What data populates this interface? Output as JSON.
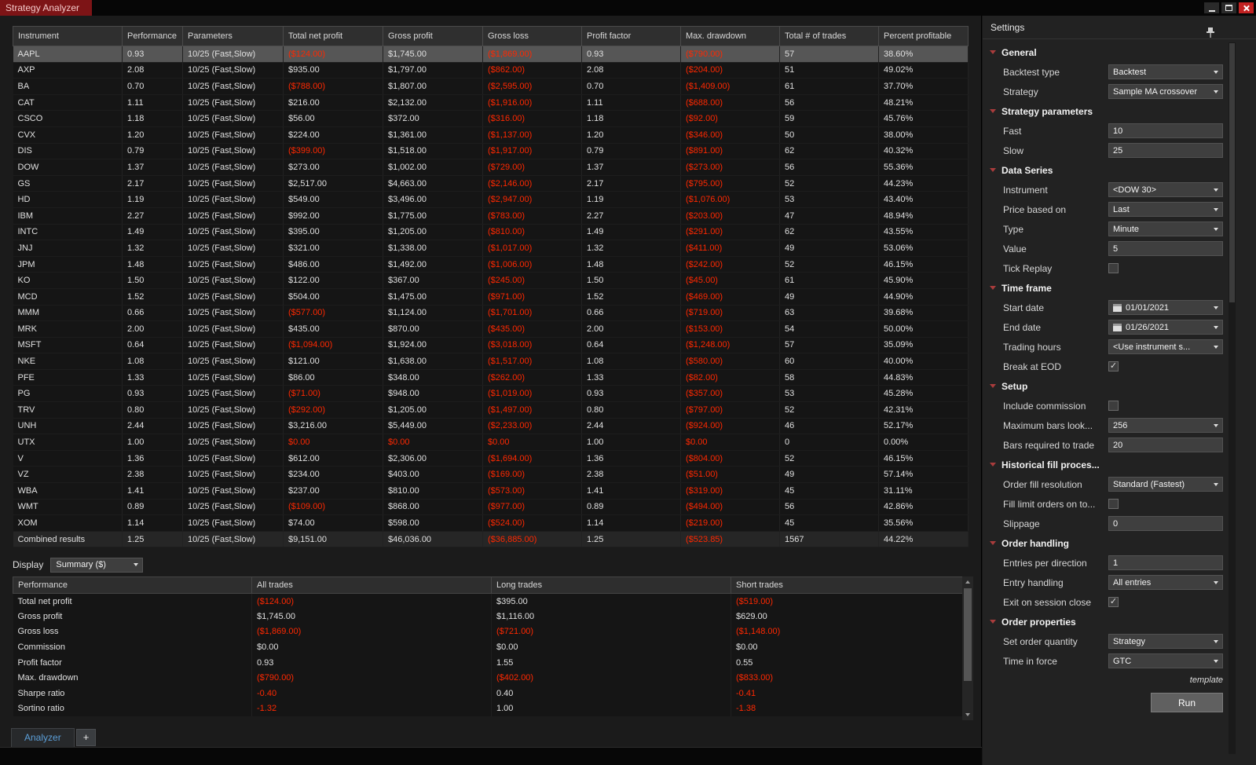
{
  "window": {
    "title": "Strategy Analyzer"
  },
  "colors": {
    "title_tab_red": "#7d1416",
    "negative_value_red": "#ff2800",
    "selected_row_gray": "#565656",
    "tab_text_blue": "#5c9fd8",
    "group_arrow_red": "#a93c3c"
  },
  "results": {
    "columns": [
      "Instrument",
      "Performance",
      "Parameters",
      "Total net profit",
      "Gross profit",
      "Gross loss",
      "Profit factor",
      "Max. drawdown",
      "Total # of trades",
      "Percent profitable"
    ],
    "currency_columns": [
      3,
      4,
      5,
      7
    ],
    "selected_row": 0,
    "rows": [
      [
        "AAPL",
        "0.93",
        "10/25 (Fast,Slow)",
        "($124.00)",
        "$1,745.00",
        "($1,869.00)",
        "0.93",
        "($790.00)",
        "57",
        "38.60%"
      ],
      [
        "AXP",
        "2.08",
        "10/25 (Fast,Slow)",
        "$935.00",
        "$1,797.00",
        "($862.00)",
        "2.08",
        "($204.00)",
        "51",
        "49.02%"
      ],
      [
        "BA",
        "0.70",
        "10/25 (Fast,Slow)",
        "($788.00)",
        "$1,807.00",
        "($2,595.00)",
        "0.70",
        "($1,409.00)",
        "61",
        "37.70%"
      ],
      [
        "CAT",
        "1.11",
        "10/25 (Fast,Slow)",
        "$216.00",
        "$2,132.00",
        "($1,916.00)",
        "1.11",
        "($688.00)",
        "56",
        "48.21%"
      ],
      [
        "CSCO",
        "1.18",
        "10/25 (Fast,Slow)",
        "$56.00",
        "$372.00",
        "($316.00)",
        "1.18",
        "($92.00)",
        "59",
        "45.76%"
      ],
      [
        "CVX",
        "1.20",
        "10/25 (Fast,Slow)",
        "$224.00",
        "$1,361.00",
        "($1,137.00)",
        "1.20",
        "($346.00)",
        "50",
        "38.00%"
      ],
      [
        "DIS",
        "0.79",
        "10/25 (Fast,Slow)",
        "($399.00)",
        "$1,518.00",
        "($1,917.00)",
        "0.79",
        "($891.00)",
        "62",
        "40.32%"
      ],
      [
        "DOW",
        "1.37",
        "10/25 (Fast,Slow)",
        "$273.00",
        "$1,002.00",
        "($729.00)",
        "1.37",
        "($273.00)",
        "56",
        "55.36%"
      ],
      [
        "GS",
        "2.17",
        "10/25 (Fast,Slow)",
        "$2,517.00",
        "$4,663.00",
        "($2,146.00)",
        "2.17",
        "($795.00)",
        "52",
        "44.23%"
      ],
      [
        "HD",
        "1.19",
        "10/25 (Fast,Slow)",
        "$549.00",
        "$3,496.00",
        "($2,947.00)",
        "1.19",
        "($1,076.00)",
        "53",
        "43.40%"
      ],
      [
        "IBM",
        "2.27",
        "10/25 (Fast,Slow)",
        "$992.00",
        "$1,775.00",
        "($783.00)",
        "2.27",
        "($203.00)",
        "47",
        "48.94%"
      ],
      [
        "INTC",
        "1.49",
        "10/25 (Fast,Slow)",
        "$395.00",
        "$1,205.00",
        "($810.00)",
        "1.49",
        "($291.00)",
        "62",
        "43.55%"
      ],
      [
        "JNJ",
        "1.32",
        "10/25 (Fast,Slow)",
        "$321.00",
        "$1,338.00",
        "($1,017.00)",
        "1.32",
        "($411.00)",
        "49",
        "53.06%"
      ],
      [
        "JPM",
        "1.48",
        "10/25 (Fast,Slow)",
        "$486.00",
        "$1,492.00",
        "($1,006.00)",
        "1.48",
        "($242.00)",
        "52",
        "46.15%"
      ],
      [
        "KO",
        "1.50",
        "10/25 (Fast,Slow)",
        "$122.00",
        "$367.00",
        "($245.00)",
        "1.50",
        "($45.00)",
        "61",
        "45.90%"
      ],
      [
        "MCD",
        "1.52",
        "10/25 (Fast,Slow)",
        "$504.00",
        "$1,475.00",
        "($971.00)",
        "1.52",
        "($469.00)",
        "49",
        "44.90%"
      ],
      [
        "MMM",
        "0.66",
        "10/25 (Fast,Slow)",
        "($577.00)",
        "$1,124.00",
        "($1,701.00)",
        "0.66",
        "($719.00)",
        "63",
        "39.68%"
      ],
      [
        "MRK",
        "2.00",
        "10/25 (Fast,Slow)",
        "$435.00",
        "$870.00",
        "($435.00)",
        "2.00",
        "($153.00)",
        "54",
        "50.00%"
      ],
      [
        "MSFT",
        "0.64",
        "10/25 (Fast,Slow)",
        "($1,094.00)",
        "$1,924.00",
        "($3,018.00)",
        "0.64",
        "($1,248.00)",
        "57",
        "35.09%"
      ],
      [
        "NKE",
        "1.08",
        "10/25 (Fast,Slow)",
        "$121.00",
        "$1,638.00",
        "($1,517.00)",
        "1.08",
        "($580.00)",
        "60",
        "40.00%"
      ],
      [
        "PFE",
        "1.33",
        "10/25 (Fast,Slow)",
        "$86.00",
        "$348.00",
        "($262.00)",
        "1.33",
        "($82.00)",
        "58",
        "44.83%"
      ],
      [
        "PG",
        "0.93",
        "10/25 (Fast,Slow)",
        "($71.00)",
        "$948.00",
        "($1,019.00)",
        "0.93",
        "($357.00)",
        "53",
        "45.28%"
      ],
      [
        "TRV",
        "0.80",
        "10/25 (Fast,Slow)",
        "($292.00)",
        "$1,205.00",
        "($1,497.00)",
        "0.80",
        "($797.00)",
        "52",
        "42.31%"
      ],
      [
        "UNH",
        "2.44",
        "10/25 (Fast,Slow)",
        "$3,216.00",
        "$5,449.00",
        "($2,233.00)",
        "2.44",
        "($924.00)",
        "46",
        "52.17%"
      ],
      [
        "UTX",
        "1.00",
        "10/25 (Fast,Slow)",
        "$0.00",
        "$0.00",
        "$0.00",
        "1.00",
        "$0.00",
        "0",
        "0.00%"
      ],
      [
        "V",
        "1.36",
        "10/25 (Fast,Slow)",
        "$612.00",
        "$2,306.00",
        "($1,694.00)",
        "1.36",
        "($804.00)",
        "52",
        "46.15%"
      ],
      [
        "VZ",
        "2.38",
        "10/25 (Fast,Slow)",
        "$234.00",
        "$403.00",
        "($169.00)",
        "2.38",
        "($51.00)",
        "49",
        "57.14%"
      ],
      [
        "WBA",
        "1.41",
        "10/25 (Fast,Slow)",
        "$237.00",
        "$810.00",
        "($573.00)",
        "1.41",
        "($319.00)",
        "45",
        "31.11%"
      ],
      [
        "WMT",
        "0.89",
        "10/25 (Fast,Slow)",
        "($109.00)",
        "$868.00",
        "($977.00)",
        "0.89",
        "($494.00)",
        "56",
        "42.86%"
      ],
      [
        "XOM",
        "1.14",
        "10/25 (Fast,Slow)",
        "$74.00",
        "$598.00",
        "($524.00)",
        "1.14",
        "($219.00)",
        "45",
        "35.56%"
      ],
      [
        "Combined results",
        "1.25",
        "10/25 (Fast,Slow)",
        "$9,151.00",
        "$46,036.00",
        "($36,885.00)",
        "1.25",
        "($523.85)",
        "1567",
        "44.22%"
      ]
    ]
  },
  "display": {
    "label": "Display",
    "value": "Summary ($)"
  },
  "summary": {
    "columns": [
      "Performance",
      "All trades",
      "Long trades",
      "Short trades"
    ],
    "rows": [
      [
        "Total net profit",
        "($124.00)",
        "$395.00",
        "($519.00)"
      ],
      [
        "Gross profit",
        "$1,745.00",
        "$1,116.00",
        "$629.00"
      ],
      [
        "Gross loss",
        "($1,869.00)",
        "($721.00)",
        "($1,148.00)"
      ],
      [
        "Commission",
        "$0.00",
        "$0.00",
        "$0.00"
      ],
      [
        "Profit factor",
        "0.93",
        "1.55",
        "0.55"
      ],
      [
        "Max. drawdown",
        "($790.00)",
        "($402.00)",
        "($833.00)"
      ],
      [
        "Sharpe ratio",
        "-0.40",
        "0.40",
        "-0.41"
      ],
      [
        "Sortino ratio",
        "-1.32",
        "1.00",
        "-1.38"
      ]
    ]
  },
  "tabs": {
    "active_label": "Analyzer",
    "add_label": "+"
  },
  "settings": {
    "title": "Settings",
    "template_label": "template",
    "run_label": "Run",
    "groups": [
      {
        "label": "General",
        "items": [
          {
            "label": "Backtest type",
            "type": "select",
            "value": "Backtest"
          },
          {
            "label": "Strategy",
            "type": "select",
            "value": "Sample MA crossover"
          }
        ]
      },
      {
        "label": "Strategy parameters",
        "items": [
          {
            "label": "Fast",
            "type": "input",
            "value": "10"
          },
          {
            "label": "Slow",
            "type": "input",
            "value": "25"
          }
        ]
      },
      {
        "label": "Data Series",
        "items": [
          {
            "label": "Instrument",
            "type": "select",
            "value": "<DOW 30>"
          },
          {
            "label": "Price based on",
            "type": "select",
            "value": "Last"
          },
          {
            "label": "Type",
            "type": "select",
            "value": "Minute"
          },
          {
            "label": "Value",
            "type": "input",
            "value": "5"
          },
          {
            "label": "Tick Replay",
            "type": "checkbox",
            "value": false
          }
        ]
      },
      {
        "label": "Time frame",
        "items": [
          {
            "label": "Start date",
            "type": "date",
            "value": "01/01/2021"
          },
          {
            "label": "End date",
            "type": "date",
            "value": "01/26/2021"
          },
          {
            "label": "Trading hours",
            "type": "select",
            "value": "<Use instrument s..."
          },
          {
            "label": "Break at EOD",
            "type": "checkbox",
            "value": true
          }
        ]
      },
      {
        "label": "Setup",
        "items": [
          {
            "label": "Include commission",
            "type": "checkbox",
            "value": false
          },
          {
            "label": "Maximum bars look...",
            "type": "select",
            "value": "256"
          },
          {
            "label": "Bars required to trade",
            "type": "input",
            "value": "20"
          }
        ]
      },
      {
        "label": "Historical fill proces...",
        "items": [
          {
            "label": "Order fill resolution",
            "type": "select",
            "value": "Standard (Fastest)"
          },
          {
            "label": "Fill limit orders on to...",
            "type": "checkbox",
            "value": false
          },
          {
            "label": "Slippage",
            "type": "input",
            "value": "0"
          }
        ]
      },
      {
        "label": "Order handling",
        "items": [
          {
            "label": "Entries per direction",
            "type": "input",
            "value": "1"
          },
          {
            "label": "Entry handling",
            "type": "select",
            "value": "All entries"
          },
          {
            "label": "Exit on session close",
            "type": "checkbox",
            "value": true
          }
        ]
      },
      {
        "label": "Order properties",
        "items": [
          {
            "label": "Set order quantity",
            "type": "select",
            "value": "Strategy"
          },
          {
            "label": "Time in force",
            "type": "select",
            "value": "GTC"
          }
        ]
      }
    ]
  }
}
